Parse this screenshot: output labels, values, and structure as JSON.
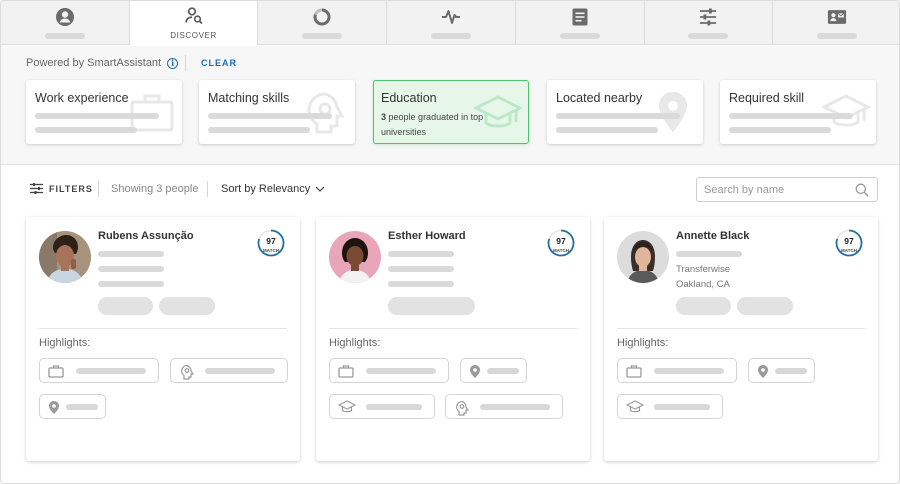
{
  "tabs": [
    {
      "name": "profile-icon",
      "label": ""
    },
    {
      "name": "discover-icon",
      "label": "DISCOVER",
      "active": true
    },
    {
      "name": "progress-ring-icon",
      "label": ""
    },
    {
      "name": "pulse-icon",
      "label": ""
    },
    {
      "name": "document-icon",
      "label": ""
    },
    {
      "name": "sliders-icon",
      "label": ""
    },
    {
      "name": "contact-card-icon",
      "label": ""
    }
  ],
  "powered_by": "Powered by SmartAssistant",
  "clear_label": "CLEAR",
  "filter_cards": [
    {
      "title": "Work experience",
      "icon": "briefcase-icon"
    },
    {
      "title": "Matching skills",
      "icon": "skills-gear-icon"
    },
    {
      "title": "Education",
      "icon": "graduation-cap-icon",
      "active": true,
      "count": "3",
      "desc": "people graduated in top universities"
    },
    {
      "title": "Located nearby",
      "icon": "location-pin-icon"
    },
    {
      "title": "Required skill",
      "icon": "graduation-cap-icon"
    }
  ],
  "toolbar": {
    "filters_label": "FILTERS",
    "showing": "Showing 3 people",
    "sort_prefix": "Sort by",
    "sort_value": "Relevancy",
    "search_placeholder": "Search by name"
  },
  "people": [
    {
      "name": "Rubens Assunção",
      "match": "97",
      "match_label": "MATCH",
      "company": "",
      "location": ""
    },
    {
      "name": "Esther Howard",
      "match": "97",
      "match_label": "MATCH",
      "company": "",
      "location": ""
    },
    {
      "name": "Annette Black",
      "match": "97",
      "match_label": "MATCH",
      "company": "Transferwise",
      "location": "Oakland, CA"
    }
  ],
  "highlights_label": "Highlights:",
  "colors": {
    "accent": "#1a6fb5",
    "active_card_bg": "#e6f7ea",
    "active_card_border": "#4fc26e"
  }
}
